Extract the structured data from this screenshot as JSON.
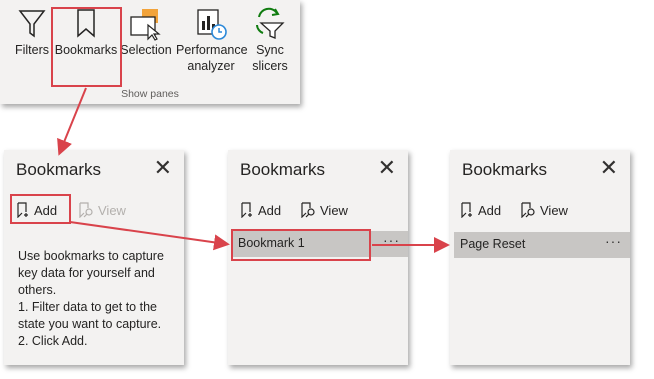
{
  "ribbon": {
    "buttons": [
      {
        "label": "Filters",
        "icon": "filter-icon"
      },
      {
        "label": "Bookmarks",
        "icon": "bookmark-icon"
      },
      {
        "label": "Selection",
        "icon": "selection-icon"
      },
      {
        "label": "Performance analyzer",
        "icon": "performance-analyzer-icon"
      },
      {
        "label": "Sync slicers",
        "icon": "sync-slicers-icon"
      }
    ],
    "group_label": "Show panes"
  },
  "panes": [
    {
      "title": "Bookmarks",
      "add_label": "Add",
      "view_label": "View",
      "description": [
        "Use bookmarks to capture",
        "key data for yourself and",
        "others.",
        "1. Filter data to get to the",
        "state you want to capture.",
        "2. Click Add."
      ]
    },
    {
      "title": "Bookmarks",
      "add_label": "Add",
      "view_label": "View",
      "bookmark": {
        "name": "Bookmark 1",
        "more": "···"
      }
    },
    {
      "title": "Bookmarks",
      "add_label": "Add",
      "view_label": "View",
      "bookmark": {
        "name": "Page Reset",
        "more": "···"
      }
    }
  ],
  "colors": {
    "highlight": "#d9434b",
    "pane_bg": "#f3f2f1",
    "selected_row": "#c8c6c4",
    "accent_orange": "#f2a33a"
  }
}
